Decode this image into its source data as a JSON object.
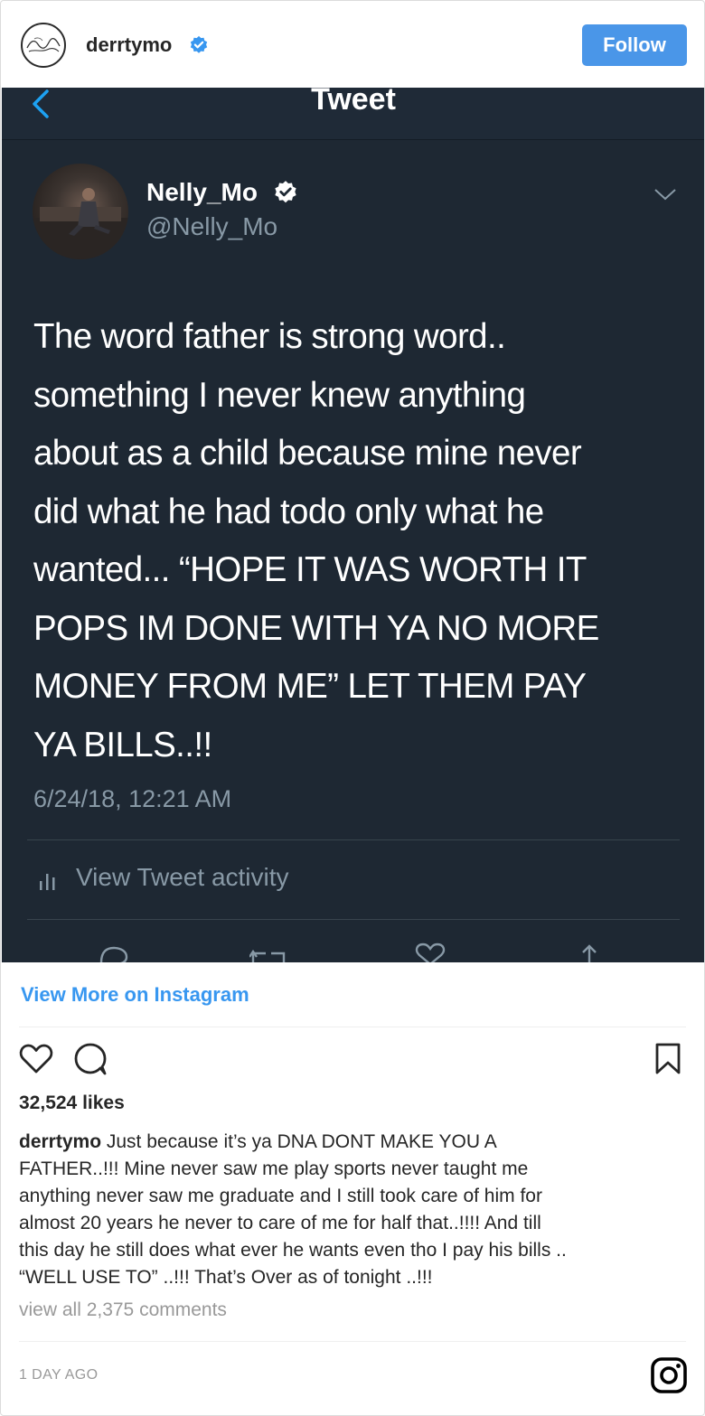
{
  "header": {
    "username": "derrtymo",
    "follow_label": "Follow"
  },
  "tweet": {
    "title": "Tweet",
    "name": "Nelly_Mo",
    "handle": "@Nelly_Mo",
    "text_lines": [
      "The word father is strong word..",
      "something I never knew anything",
      "about as a child because mine never",
      "did what he had todo only what he",
      "wanted... “HOPE IT WAS WORTH IT",
      "POPS IM DONE WITH YA NO MORE",
      "MONEY FROM ME” LET THEM PAY",
      "YA BILLS..!!"
    ],
    "date": "6/24/18, 12:21 AM",
    "activity_label": "View Tweet activity"
  },
  "view_more_label": "View More on Instagram",
  "likes": "32,524 likes",
  "caption": {
    "username": "derrtymo",
    "first_line_rest": " Just because it’s ya DNA DONT MAKE YOU A",
    "lines": [
      "FATHER..!!! Mine never saw me play sports never taught me",
      "anything never saw me graduate and I still took care of him for",
      "almost 20 years he never to care of me for half that..!!!! And till",
      "this day he still does what ever he wants even tho I pay his bills ..",
      "“WELL USE TO” ..!!! That’s Over as of tonight ..!!!"
    ]
  },
  "comments_label": "view all 2,375 comments",
  "timestamp": "1 DAY AGO",
  "colors": {
    "follow_blue": "#4a96e8",
    "link_blue": "#3897f0",
    "tweet_bg": "#1e2833",
    "tweet_secondary": "#8899a6"
  },
  "icons": [
    "verified-badge-icon",
    "back-chevron-icon",
    "chevron-down-icon",
    "bar-chart-icon",
    "reply-icon",
    "retweet-icon",
    "like-icon",
    "share-icon",
    "heart-icon",
    "comment-icon",
    "bookmark-icon",
    "instagram-logo-icon"
  ]
}
